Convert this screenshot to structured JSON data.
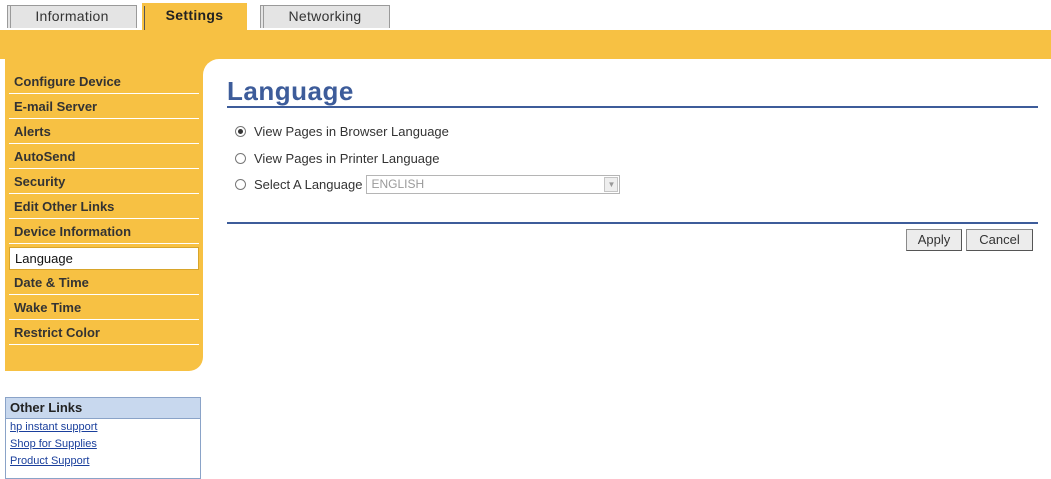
{
  "tabs": [
    {
      "label": "Information",
      "active": false
    },
    {
      "label": "Settings",
      "active": true
    },
    {
      "label": "Networking",
      "active": false
    }
  ],
  "sidebar": {
    "items": [
      {
        "label": "Configure Device"
      },
      {
        "label": "E-mail Server"
      },
      {
        "label": "Alerts"
      },
      {
        "label": "AutoSend"
      },
      {
        "label": "Security"
      },
      {
        "label": "Edit Other Links"
      },
      {
        "label": "Device Information"
      },
      {
        "label": "Language",
        "active": true
      },
      {
        "label": "Date & Time"
      },
      {
        "label": "Wake Time"
      },
      {
        "label": "Restrict Color"
      }
    ]
  },
  "other_links": {
    "title": "Other Links",
    "links": [
      "hp instant support",
      "Shop for Supplies",
      "Product Support"
    ]
  },
  "main": {
    "title": "Language",
    "options": [
      {
        "label": "View Pages in Browser Language",
        "checked": true
      },
      {
        "label": "View Pages in Printer Language",
        "checked": false
      },
      {
        "label": "Select A Language",
        "checked": false
      }
    ],
    "language_select": {
      "value": "ENGLISH"
    },
    "buttons": {
      "apply": "Apply",
      "cancel": "Cancel"
    }
  },
  "colors": {
    "accent_orange": "#f7c143",
    "title_blue": "#3d5c9a",
    "link_blue": "#1a3f9c"
  }
}
